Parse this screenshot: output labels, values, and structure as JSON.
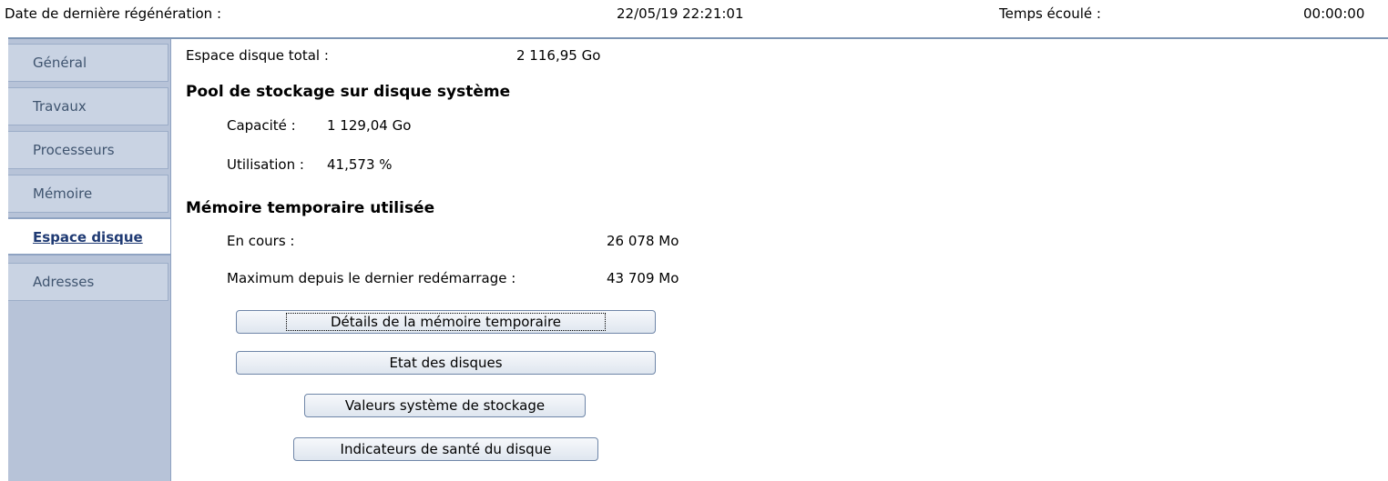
{
  "header": {
    "last_refresh_label": "Date de dernière régénération :",
    "last_refresh_value": "22/05/19 22:21:01",
    "elapsed_label": "Temps écoulé :",
    "elapsed_value": "00:00:00"
  },
  "sidebar": {
    "items": [
      {
        "label": "Général"
      },
      {
        "label": "Travaux"
      },
      {
        "label": "Processeurs"
      },
      {
        "label": "Mémoire"
      },
      {
        "label": "Espace disque",
        "active": true
      },
      {
        "label": "Adresses"
      }
    ]
  },
  "main": {
    "total_space_label": "Espace disque total :",
    "total_space_value": "2 116,95 Go",
    "pool_title": "Pool de stockage sur disque système",
    "capacity_label": "Capacité :",
    "capacity_value": "1 129,04 Go",
    "usage_label": "Utilisation :",
    "usage_value": "41,573 %",
    "temp_title": "Mémoire temporaire utilisée",
    "current_label": "En cours :",
    "current_value": "26 078 Mo",
    "max_label": "Maximum depuis le dernier redémarrage :",
    "max_value": "43 709 Mo",
    "buttons": {
      "temp_details": "Détails de la mémoire temporaire",
      "disk_status": "Etat des disques",
      "storage_values": "Valeurs système de stockage",
      "disk_health": "Indicateurs de santé du disque"
    }
  }
}
